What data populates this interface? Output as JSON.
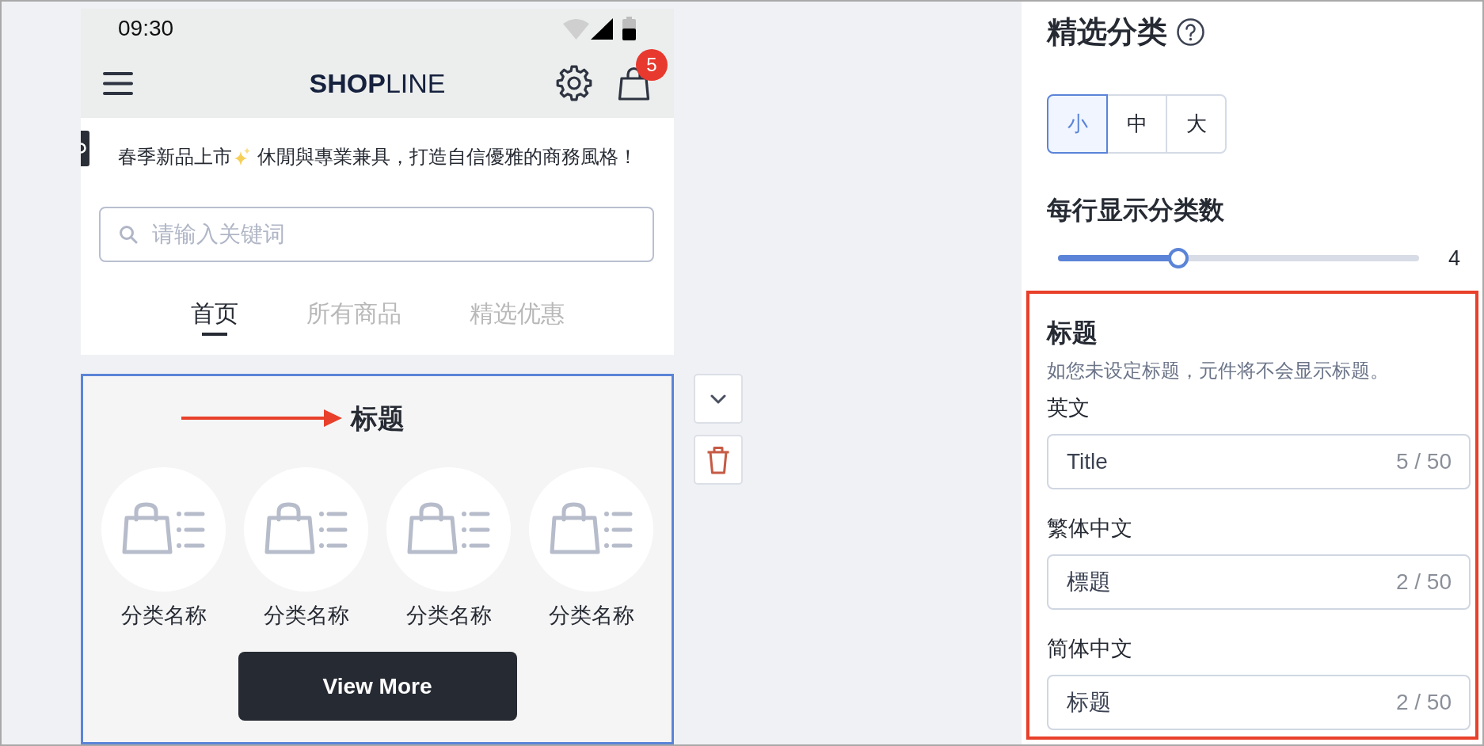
{
  "status_bar": {
    "time": "09:30"
  },
  "store_header": {
    "logo": "**SHOP**LINE",
    "cart_count": "5"
  },
  "announcement": {
    "before": "春季新品上市",
    "after": "休閒與專業兼具，打造自信優雅的商務風格！"
  },
  "search": {
    "placeholder": "请输入关键词"
  },
  "tabs": [
    {
      "label": "首页",
      "selected": true
    },
    {
      "label": "所有商品",
      "selected": false
    },
    {
      "label": "精选优惠",
      "selected": false
    }
  ],
  "category_section": {
    "selected": true,
    "title": "标题",
    "categories": [
      {
        "name": "分类名称"
      },
      {
        "name": "分类名称"
      },
      {
        "name": "分类名称"
      },
      {
        "name": "分类名称"
      }
    ],
    "button": "View More"
  },
  "settings": {
    "title": "精选分类",
    "image_size_options": [
      {
        "label": "小",
        "selected": true
      },
      {
        "label": "中",
        "selected": false
      },
      {
        "label": "大",
        "selected": false
      }
    ],
    "per_row": {
      "label": "每行显示分类数",
      "level": 0.333,
      "value": "4"
    },
    "title_settings": {
      "highlighted": true,
      "heading": "标题",
      "hint": "如您未设定标题，元件将不会显示标题。",
      "fields": [
        {
          "label": "英文",
          "value": "Title",
          "count": "5 / 50"
        },
        {
          "label": "繁体中文",
          "value": "標題",
          "count": "2 / 50"
        },
        {
          "label": "简体中文",
          "value": "标题",
          "count": "2 / 50"
        }
      ]
    }
  }
}
